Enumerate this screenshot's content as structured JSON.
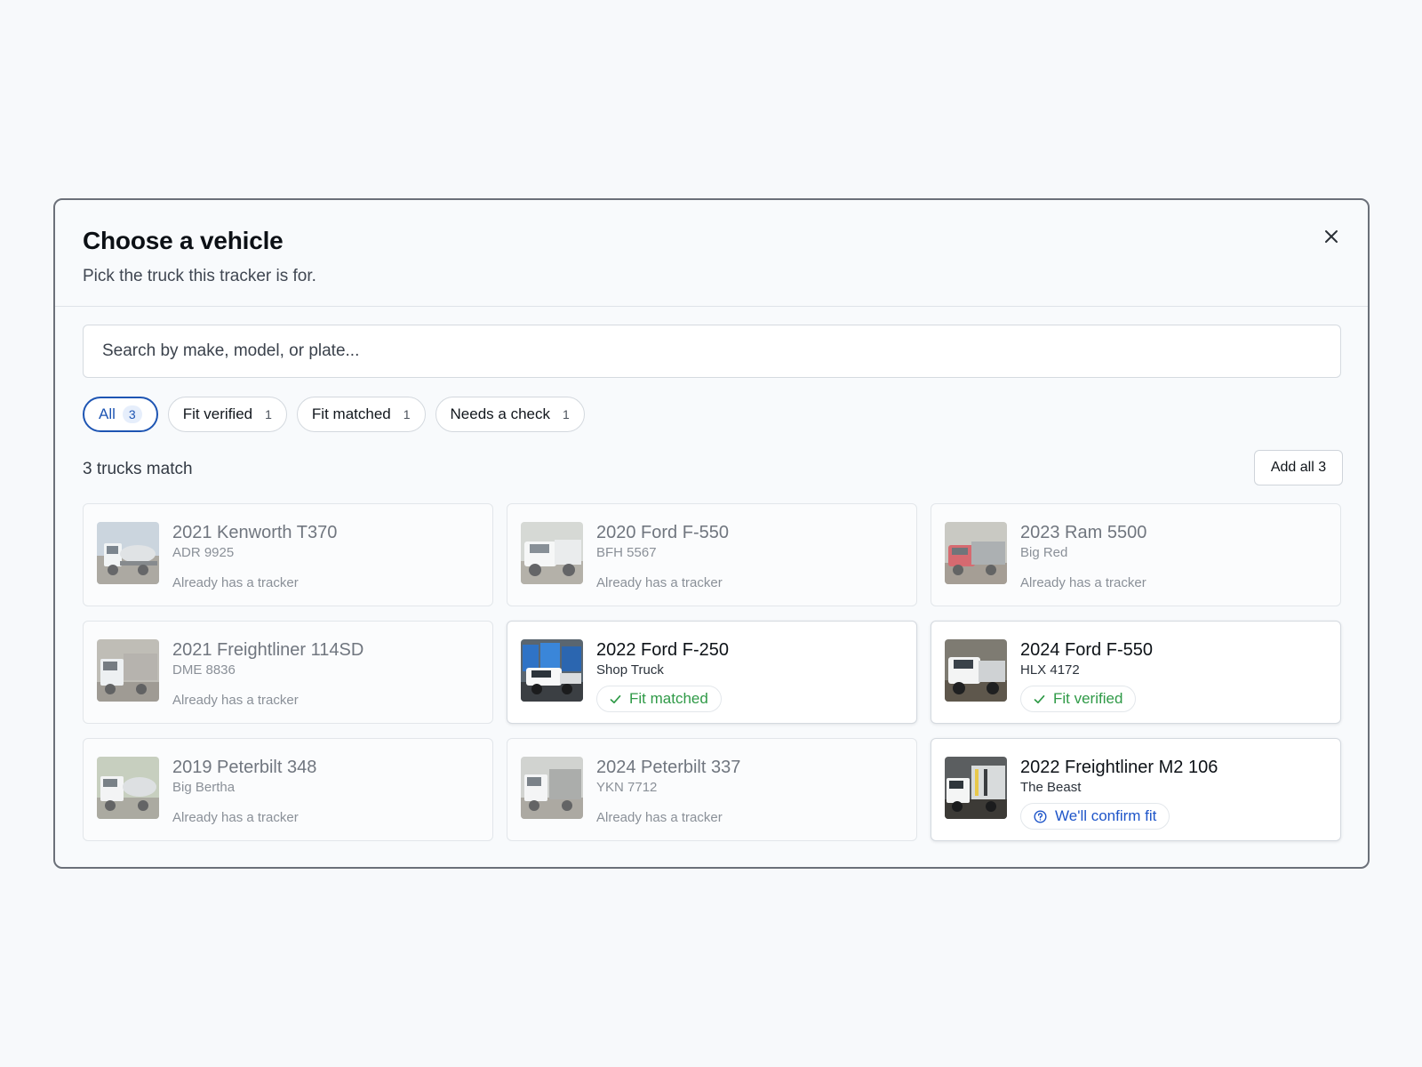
{
  "modal": {
    "title": "Choose a vehicle",
    "subtitle": "Pick the truck this tracker is for.",
    "close_icon": "close-icon"
  },
  "search": {
    "placeholder": "Search by make, model, or plate..."
  },
  "filters": [
    {
      "label": "All",
      "count": "3",
      "active": true
    },
    {
      "label": "Fit verified",
      "count": "1",
      "active": false
    },
    {
      "label": "Fit matched",
      "count": "1",
      "active": false
    },
    {
      "label": "Needs a check",
      "count": "1",
      "active": false
    }
  ],
  "results": {
    "count_text": "3 trucks match",
    "add_all_label": "Add all 3"
  },
  "vehicles": [
    {
      "name": "2021 Kenworth T370",
      "sub": "ADR 9925",
      "note": "Already has a tracker",
      "status": "disabled"
    },
    {
      "name": "2020 Ford F-550",
      "sub": "BFH 5567",
      "note": "Already has a tracker",
      "status": "disabled"
    },
    {
      "name": "2023 Ram 5500",
      "sub": "Big Red",
      "note": "Already has a tracker",
      "status": "disabled"
    },
    {
      "name": "2021 Freightliner 114SD",
      "sub": "DME 8836",
      "note": "Already has a tracker",
      "status": "disabled"
    },
    {
      "name": "2022 Ford F-250",
      "sub": "Shop Truck",
      "badge": "Fit matched",
      "status": "matched"
    },
    {
      "name": "2024 Ford F-550",
      "sub": "HLX 4172",
      "badge": "Fit verified",
      "status": "verified"
    },
    {
      "name": "2019 Peterbilt 348",
      "sub": "Big Bertha",
      "note": "Already has a tracker",
      "status": "disabled"
    },
    {
      "name": "2024 Peterbilt 337",
      "sub": "YKN 7712",
      "note": "Already has a tracker",
      "status": "disabled"
    },
    {
      "name": "2022 Freightliner M2 106",
      "sub": "The Beast",
      "badge": "We'll confirm fit",
      "status": "confirm"
    }
  ],
  "colors": {
    "accent": "#1e55b3",
    "success": "#2f9a47",
    "info": "#1e55c9"
  }
}
